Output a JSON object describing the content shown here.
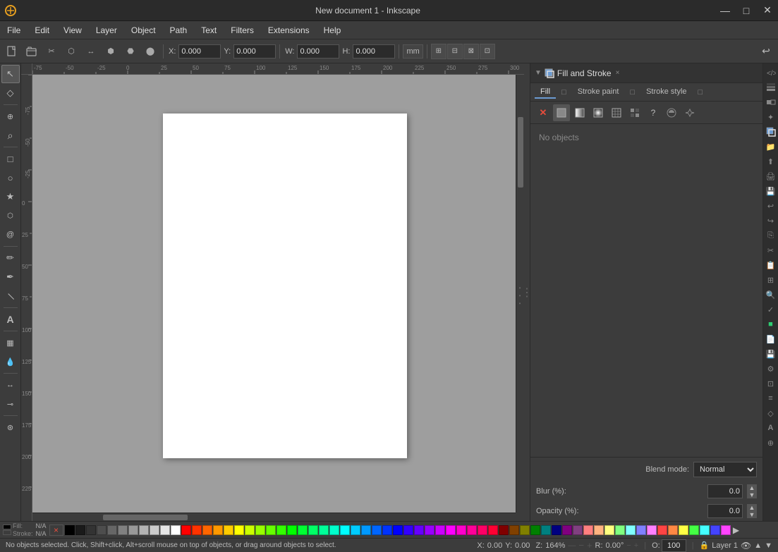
{
  "titlebar": {
    "title": "New document 1 - Inkscape",
    "app_icon": "✏",
    "minimize": "—",
    "maximize": "□",
    "close": "✕"
  },
  "menubar": {
    "items": [
      "File",
      "Edit",
      "View",
      "Layer",
      "Object",
      "Path",
      "Text",
      "Filters",
      "Extensions",
      "Help"
    ]
  },
  "toolbar": {
    "x_label": "X:",
    "x_value": "0.000",
    "y_label": "Y:",
    "y_value": "0.000",
    "w_label": "W:",
    "w_value": "0.000",
    "h_label": "H:",
    "h_value": "0.000",
    "unit": "mm"
  },
  "toolbox": {
    "tools": [
      {
        "name": "selector",
        "icon": "↖",
        "title": "Selector tool"
      },
      {
        "name": "node",
        "icon": "◇",
        "title": "Node tool"
      },
      {
        "name": "tweak",
        "icon": "~",
        "title": "Tweak tool"
      },
      {
        "name": "zoom",
        "icon": "⌕",
        "title": "Zoom tool"
      },
      {
        "name": "rect",
        "icon": "□",
        "title": "Rectangle tool"
      },
      {
        "name": "ellipse",
        "icon": "○",
        "title": "Ellipse tool"
      },
      {
        "name": "star",
        "icon": "★",
        "title": "Star tool"
      },
      {
        "name": "3d-box",
        "icon": "⬡",
        "title": "3D Box tool"
      },
      {
        "name": "spiral",
        "icon": "🌀",
        "title": "Spiral tool"
      },
      {
        "name": "pencil",
        "icon": "✏",
        "title": "Pencil tool"
      },
      {
        "name": "pen",
        "icon": "✒",
        "title": "Pen tool"
      },
      {
        "name": "calligraphy",
        "icon": "∫",
        "title": "Calligraphy tool"
      },
      {
        "name": "text",
        "icon": "A",
        "title": "Text tool"
      },
      {
        "name": "gradient",
        "icon": "▦",
        "title": "Gradient tool"
      },
      {
        "name": "dropper",
        "icon": "💧",
        "title": "Dropper tool"
      },
      {
        "name": "connector",
        "icon": "↔",
        "title": "Connector tool"
      },
      {
        "name": "measure",
        "icon": "📏",
        "title": "Measure tool"
      }
    ]
  },
  "right_panel": {
    "header": {
      "title": "Fill and Stroke",
      "close_label": "×"
    },
    "tabs": [
      "Fill",
      "Stroke paint",
      "Stroke style"
    ],
    "paint_buttons": [
      "×",
      "□",
      "■",
      "▦",
      "⬡",
      "?",
      "shield",
      "heart"
    ],
    "no_objects_text": "No objects",
    "blend_label": "Blend mode:",
    "blend_value": "Normal",
    "blur_label": "Blur (%):",
    "blur_value": "0.0",
    "opacity_label": "Opacity (%):",
    "opacity_value": "0.0"
  },
  "statusbar": {
    "message": "No objects selected. Click, Shift+click, Alt+scroll mouse on top of objects, or drag around objects to select.",
    "x_label": "X:",
    "x_value": "0.00",
    "y_label": "Y:",
    "y_value": "0.00",
    "zoom_label": "Z:",
    "zoom_value": "164%",
    "rotation_label": "R:",
    "rotation_value": "0.00°",
    "fill_label": "Fill:",
    "fill_value": "N/A",
    "stroke_label": "Stroke:",
    "stroke_value": "N/A",
    "opacity_label": "O:",
    "opacity_value": "100",
    "layer_name": "Layer 1"
  },
  "palette": {
    "no_color": "×",
    "colors": [
      "#000000",
      "#1a1a1a",
      "#333333",
      "#4d4d4d",
      "#666666",
      "#808080",
      "#999999",
      "#b3b3b3",
      "#cccccc",
      "#e6e6e6",
      "#ffffff",
      "#ff0000",
      "#ff3300",
      "#ff6600",
      "#ff9900",
      "#ffcc00",
      "#ffff00",
      "#ccff00",
      "#99ff00",
      "#66ff00",
      "#33ff00",
      "#00ff00",
      "#00ff33",
      "#00ff66",
      "#00ff99",
      "#00ffcc",
      "#00ffff",
      "#00ccff",
      "#0099ff",
      "#0066ff",
      "#0033ff",
      "#0000ff",
      "#3300ff",
      "#6600ff",
      "#9900ff",
      "#cc00ff",
      "#ff00ff",
      "#ff00cc",
      "#ff0099",
      "#ff0066",
      "#ff0033",
      "#800000",
      "#804000",
      "#808000",
      "#008000",
      "#008080",
      "#000080",
      "#800080",
      "#804080",
      "#ff8080",
      "#ffb380",
      "#ffff80",
      "#80ff80",
      "#80ffff",
      "#8080ff",
      "#ff80ff",
      "#ff4444",
      "#ff8844",
      "#ffff44",
      "#44ff44",
      "#44ffff",
      "#4444ff",
      "#ff44ff"
    ]
  }
}
